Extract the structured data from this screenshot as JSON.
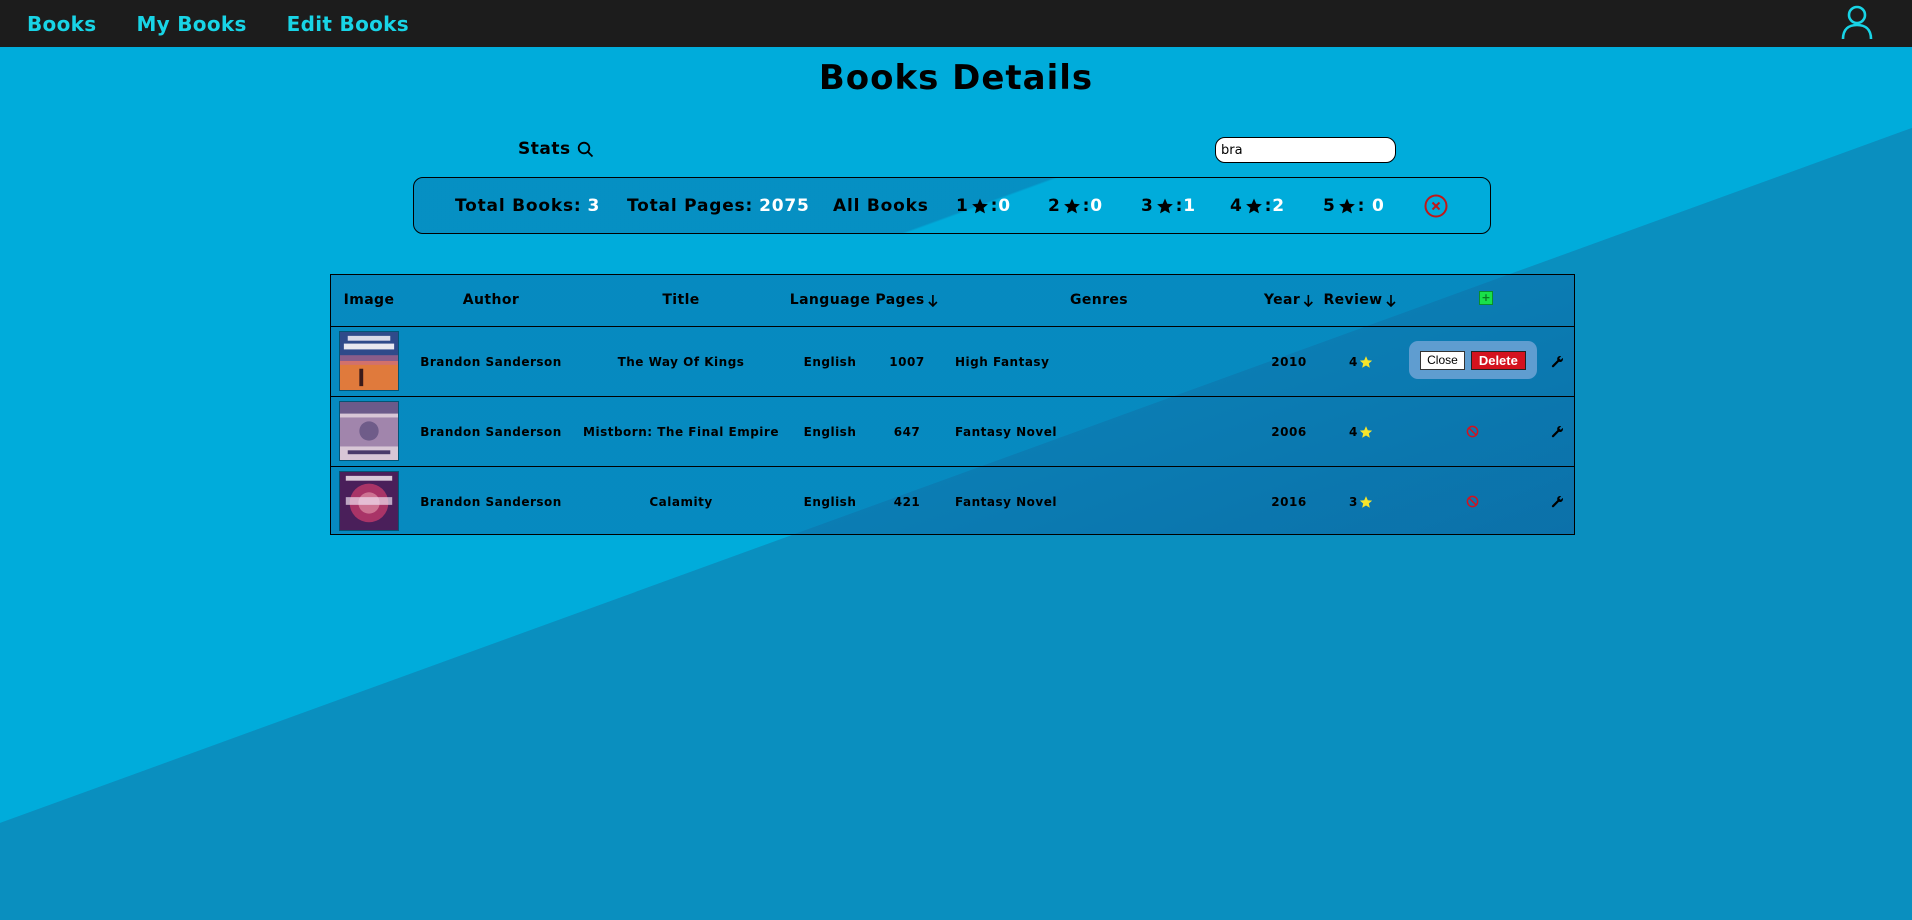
{
  "nav": {
    "links": [
      "Books",
      "My Books",
      "Edit Books"
    ],
    "user_icon": "user-icon",
    "link_color": "#18d4e6"
  },
  "page": {
    "title": "Books Details"
  },
  "stats_toggle": {
    "label": "Stats",
    "icon": "search-icon"
  },
  "search": {
    "value": "bra"
  },
  "stats": {
    "total_books_label": "Total Books:",
    "total_books": "3",
    "total_pages_label": "Total Pages:",
    "total_pages": "2075",
    "all_books_label": "All Books",
    "ratings": [
      {
        "stars": "1",
        "sep": ":",
        "count": "0"
      },
      {
        "stars": "2",
        "sep": ":",
        "count": "0"
      },
      {
        "stars": "3",
        "sep": ":",
        "count": "1"
      },
      {
        "stars": "4",
        "sep": ":",
        "count": "2"
      },
      {
        "stars": "5",
        "sep": ": ",
        "count": "0"
      }
    ],
    "clear_icon": "close-circle-icon"
  },
  "table": {
    "headers": {
      "image": "Image",
      "author": "Author",
      "title": "Title",
      "language": "Language",
      "pages": "Pages",
      "genres": "Genres",
      "year": "Year",
      "review": "Review",
      "add": "+"
    },
    "rows": [
      {
        "author": "Brandon Sanderson",
        "title": "The Way Of Kings",
        "language": "English",
        "pages": "1007",
        "genres": "High Fantasy",
        "year": "2010",
        "review": "4",
        "cover_colors": [
          "#2f4a8a",
          "#e07a3c"
        ]
      },
      {
        "author": "Brandon Sanderson",
        "title": "Mistborn: The Final Empire",
        "language": "English",
        "pages": "647",
        "genres": "Fantasy Novel",
        "year": "2006",
        "review": "4",
        "cover_colors": [
          "#6c5a8a",
          "#d8c6d6"
        ]
      },
      {
        "author": "Brandon Sanderson",
        "title": "Calamity",
        "language": "English",
        "pages": "421",
        "genres": "Fantasy Novel",
        "year": "2016",
        "review": "3",
        "cover_colors": [
          "#4a1f5a",
          "#c03a6a"
        ]
      }
    ],
    "confirm": {
      "close_label": "Close",
      "delete_label": "Delete"
    }
  },
  "colors": {
    "accent": "#18d4e6",
    "delete": "#d4121e",
    "add": "#19e04a",
    "star": "#f7e52a"
  }
}
